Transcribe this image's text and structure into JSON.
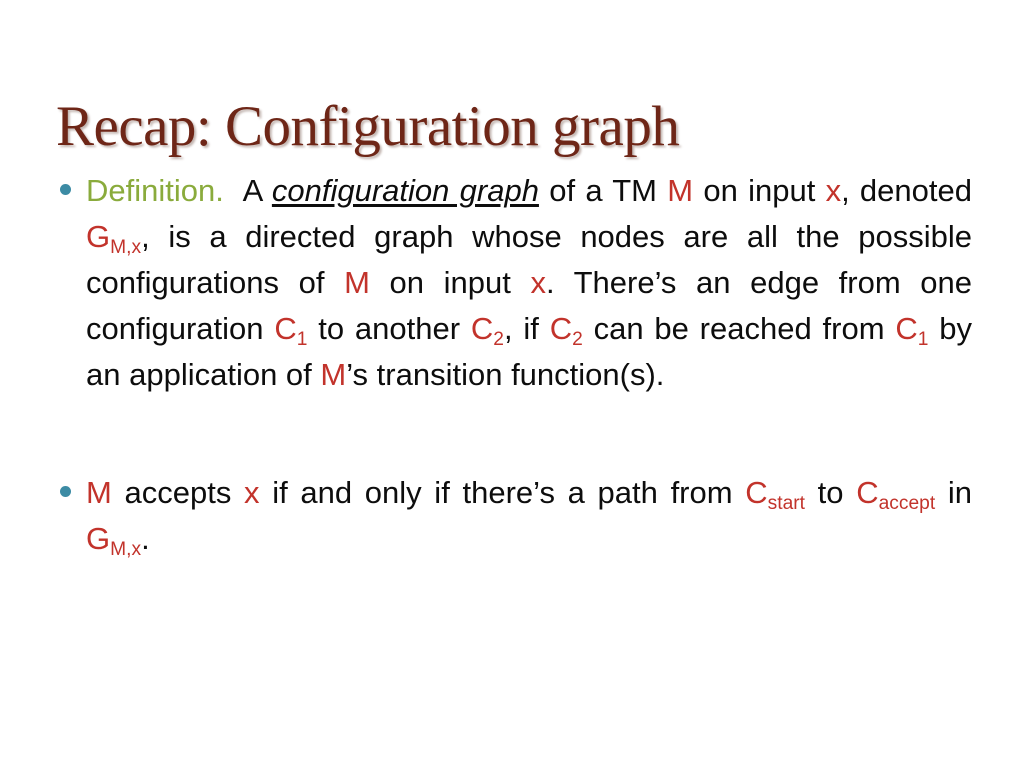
{
  "slide": {
    "title": "Recap: Configuration graph",
    "title_color": "#6e2617",
    "background_color": "#ffffff",
    "accent_colors": {
      "bullet": "#3c8ba4",
      "definition_label": "#8aab3c",
      "symbol_red": "#c2332b",
      "body_text": "#0d0d0d"
    }
  },
  "bullets": [
    {
      "marker": "bullet-dot",
      "definition_label": "Definition.",
      "text_1": "A ",
      "term": "configuration graph",
      "text_2": " of a TM ",
      "sym_M_1": "M",
      "text_3": " on input ",
      "sym_x_1": "x",
      "text_4": ", denoted ",
      "sym_G_1": "G",
      "sym_G_1_sub": "M,x",
      "text_5": ", is a directed graph whose nodes are all the possible configurations of ",
      "sym_M_2": "M",
      "text_6": " on input ",
      "sym_x_2": "x",
      "text_7": ". There’s an edge from one configuration ",
      "sym_C_1": "C",
      "sym_C_1_sub": "1",
      "text_8": " to another ",
      "sym_C_2": "C",
      "sym_C_2_sub": "2",
      "text_9": ", if ",
      "sym_C_3": "C",
      "sym_C_3_sub": "2",
      "text_10": " can be reached from ",
      "sym_C_4": "C",
      "sym_C_4_sub": "1",
      "text_11": " by an application of ",
      "sym_M_3": "M",
      "text_12": "’s transition function(s)."
    },
    {
      "marker": "bullet-dot",
      "sym_M_1": "M",
      "text_1": " accepts ",
      "sym_x_1": "x",
      "text_2": " if and only if there’s a path from ",
      "sym_C_start": "C",
      "sym_C_start_sub": "start",
      "text_3": " to ",
      "sym_C_accept": "C",
      "sym_C_accept_sub": "accept",
      "text_4": " in ",
      "sym_G": "G",
      "sym_G_sub": "M,x",
      "text_5": "."
    }
  ]
}
